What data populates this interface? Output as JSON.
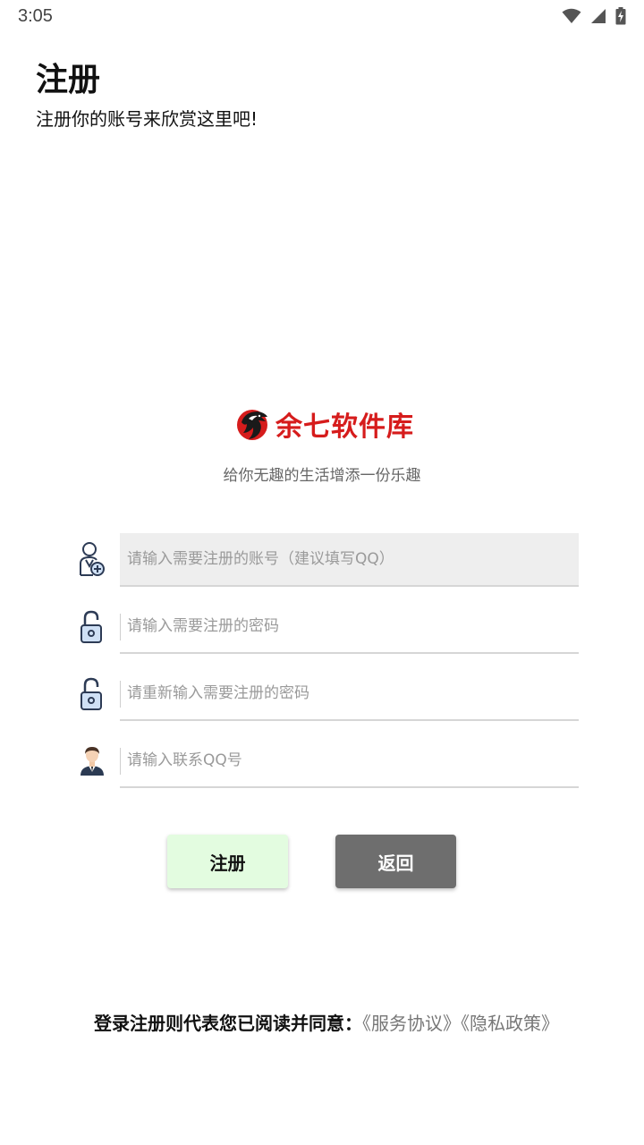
{
  "status_bar": {
    "time": "3:05"
  },
  "header": {
    "title": "注册",
    "subtitle": "注册你的账号来欣赏这里吧!"
  },
  "brand": {
    "name": "余七软件库",
    "slogan": "给你无趣的生活增添一份乐趣",
    "color": "#d61c1c"
  },
  "form": {
    "account_placeholder": "请输入需要注册的账号（建议填写QQ）",
    "password_placeholder": "请输入需要注册的密码",
    "confirm_password_placeholder": "请重新输入需要注册的密码",
    "qq_placeholder": "请输入联系QQ号"
  },
  "buttons": {
    "register_label": "注册",
    "back_label": "返回",
    "register_color": "#e3fce0",
    "back_color": "#6e6e6e"
  },
  "agreement": {
    "prefix": "登录注册则代表您已阅读并同意：",
    "service_link": "《服务协议》",
    "privacy_link": "《隐私政策》"
  }
}
